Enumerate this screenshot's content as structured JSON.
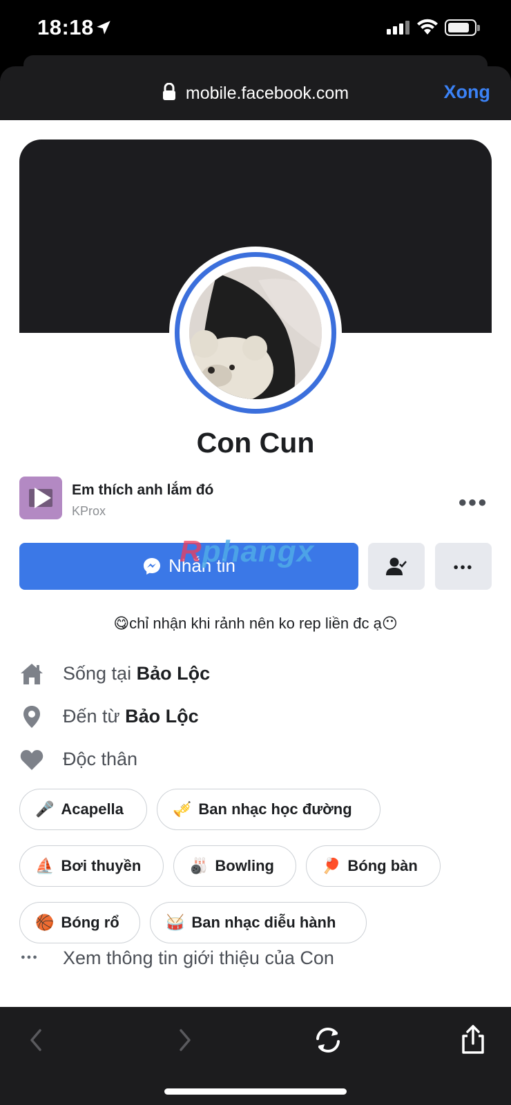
{
  "status_bar": {
    "time": "18:18"
  },
  "browser": {
    "url": "mobile.facebook.com",
    "done_label": "Xong"
  },
  "profile": {
    "name": "Con Cun",
    "song": {
      "title": "Em thích anh lắm đó",
      "artist": "KProx"
    },
    "message_button": "Nhắn tin",
    "bio": "😋chỉ nhận khi rảnh nên ko rep liền đc ạ😶",
    "info": [
      {
        "prefix": "Sống tại ",
        "value": "Bảo Lộc",
        "icon": "home-icon"
      },
      {
        "prefix": "Đến từ ",
        "value": "Bảo Lộc",
        "icon": "location-pin-icon"
      },
      {
        "prefix": "Độc thân",
        "value": "",
        "icon": "heart-icon"
      }
    ],
    "interests": [
      {
        "emoji": "🎤",
        "label": "Acapella"
      },
      {
        "emoji": "🎺",
        "label": "Ban nhạc học đường"
      },
      {
        "emoji": "⛵",
        "label": "Bơi thuyền"
      },
      {
        "emoji": "🎳",
        "label": "Bowling"
      },
      {
        "emoji": "🏓",
        "label": "Bóng bàn"
      },
      {
        "emoji": "🏀",
        "label": "Bóng rổ"
      },
      {
        "emoji": "🥁",
        "label": "Ban nhạc diễu hành"
      }
    ],
    "see_more": "Xem thông tin giới thiệu của Con"
  },
  "watermark": "Phangx",
  "colors": {
    "accent": "#3b78e7",
    "done_blue": "#3b82f6",
    "cover": "#1c1c1f"
  }
}
